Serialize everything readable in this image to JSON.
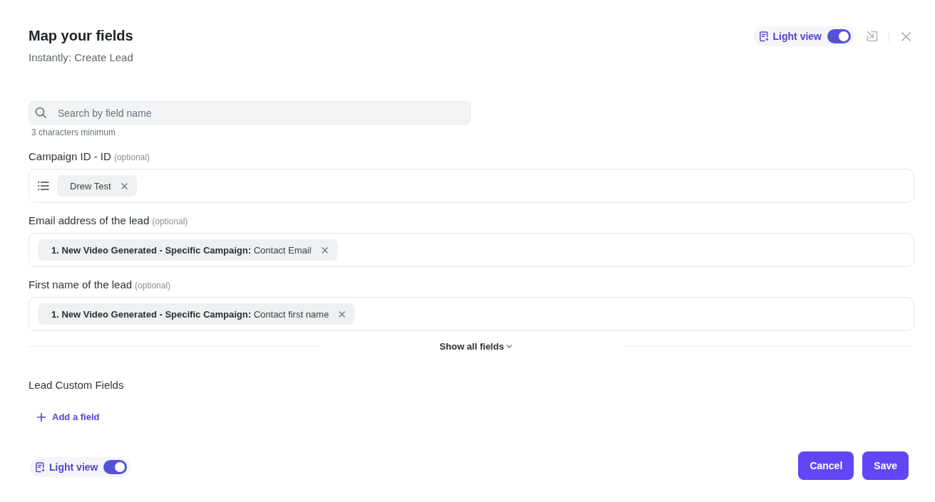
{
  "header": {
    "title": "Map your fields",
    "subtitle": "Instantly: Create Lead",
    "light_view": {
      "label": "Light view",
      "on": true
    }
  },
  "search": {
    "placeholder": "Search by field name",
    "hint": "3 characters minimum"
  },
  "fields": [
    {
      "label": "Campaign ID - ID",
      "note": "(optional)",
      "kind": "list",
      "chips": [
        "Drew Test"
      ]
    },
    {
      "label": "Email address of the lead",
      "note": "(optional)",
      "kind": "mapped",
      "chips": [
        "**1. New Video Generated - Specific Campaign:** Contact Email"
      ]
    },
    {
      "label": "First name of the lead",
      "note": "(optional)",
      "kind": "mapped",
      "chips": [
        "**1. New Video Generated - Specific Campaign:** Contact first name"
      ]
    }
  ],
  "show_all": {
    "label": "Show all fields",
    "expanded": false
  },
  "custom_fields": {
    "heading": "Lead Custom Fields",
    "add_button": "Add a field"
  },
  "footer": {
    "light_view": {
      "label": "Light view",
      "on": true
    },
    "buttons": [
      "Cancel",
      "Save"
    ]
  }
}
